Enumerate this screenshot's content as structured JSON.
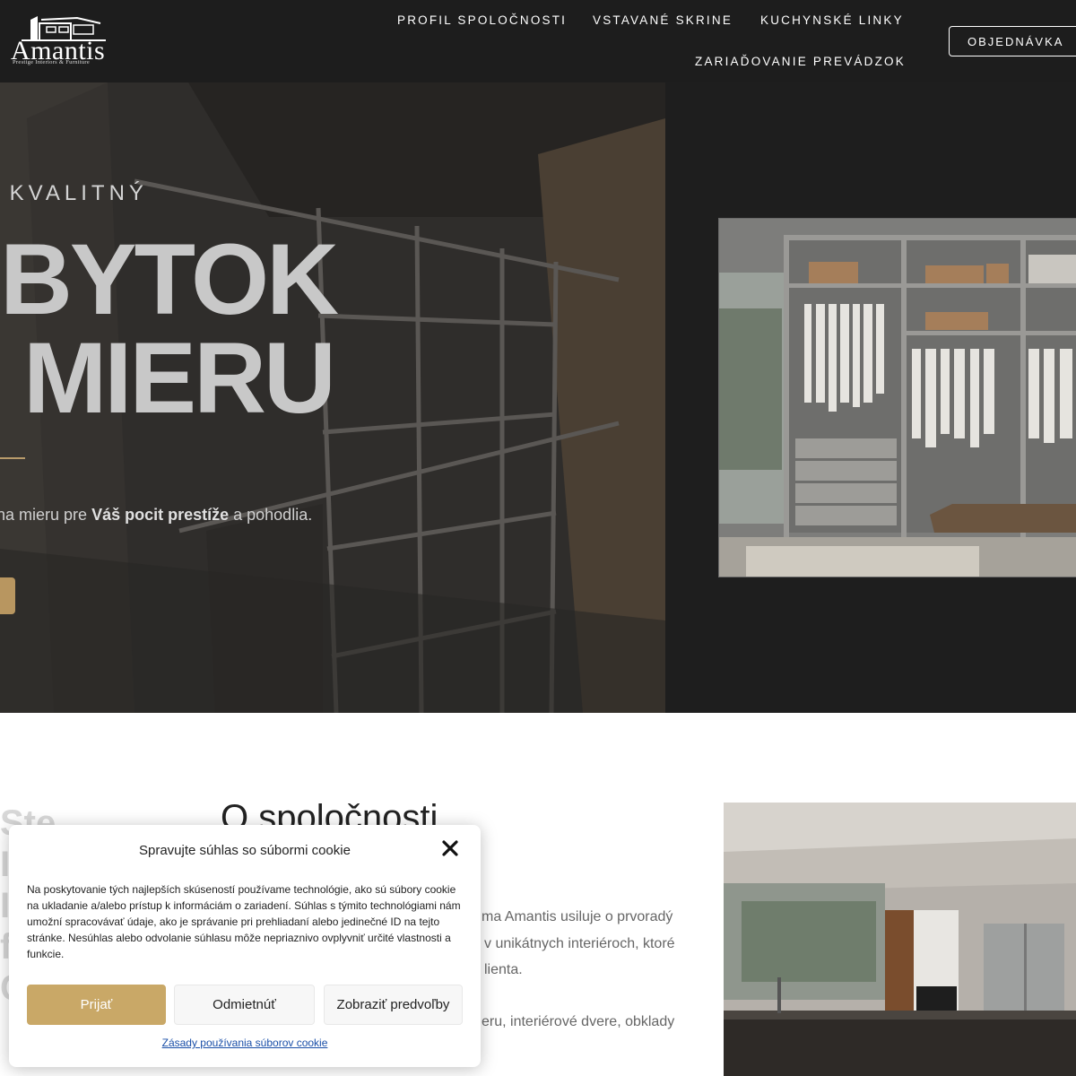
{
  "header": {
    "logo": {
      "name": "Amantis",
      "tagline": "Prestige Interiors & Furniture"
    },
    "nav": [
      "PROFIL SPOLOČNOSTI",
      "VSTAVANÉ SKRINE",
      "KUCHYNSKÉ LINKY",
      "ZARIAĎOVANIE PREVÁDZOK"
    ],
    "order_button": "OBJEDNÁVKA"
  },
  "hero": {
    "eyebrow": "E KVALITNÝ",
    "title_line1": "BYTOK",
    "title_line2": "MIERU",
    "desc_before": "na mieru pre ",
    "desc_bold": "Váš pocit prestíže",
    "desc_after": " a pohodlia."
  },
  "about": {
    "side_letters": [
      "Ste",
      "I",
      "I",
      "f",
      "C"
    ],
    "title": "O spoločnosti",
    "text_lines": [
      "ma Amantis usiluje o prvoradý",
      "v unikátnych interiéroch, ktoré",
      "lienta.",
      "eru,  interiérové dvere, obklady"
    ]
  },
  "cookie": {
    "title": "Spravujte súhlas so súbormi cookie",
    "body": "Na poskytovanie tých najlepších skúseností používame technológie, ako sú súbory cookie na ukladanie a/alebo prístup k informáciám o zariadení. Súhlas s týmito technológiami nám umožní spracovávať údaje, ako je správanie pri prehliadaní alebo jedinečné ID na tejto stránke. Nesúhlas alebo odvolanie súhlasu môže nepriaznivo ovplyvniť určité vlastnosti a funkcie.",
    "accept": "Prijať",
    "deny": "Odmietnúť",
    "preferences": "Zobraziť predvoľby",
    "policy_link": "Zásady používania súborov cookie"
  },
  "colors": {
    "header_bg": "#1d1d1d",
    "accent_gold": "#c9a867",
    "hero_line": "#b89b6b",
    "link_blue": "#1a4fa8"
  },
  "icons": [
    "close-icon"
  ]
}
